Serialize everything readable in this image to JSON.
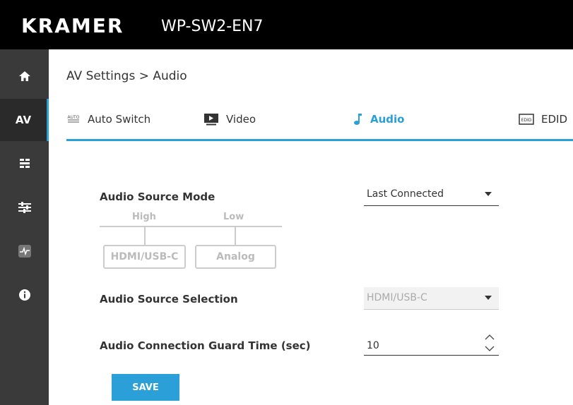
{
  "header": {
    "brand": "KRAMER",
    "model": "WP-SW2-EN7"
  },
  "sidebar": {
    "items": [
      {
        "name": "home-icon",
        "label": ""
      },
      {
        "name": "av-item",
        "label": "AV"
      },
      {
        "name": "device-icon",
        "label": ""
      },
      {
        "name": "sliders-icon",
        "label": ""
      },
      {
        "name": "diagnostics-icon",
        "label": ""
      },
      {
        "name": "info-icon",
        "label": ""
      }
    ],
    "accent": "#2a9fd8"
  },
  "breadcrumb": "AV Settings > Audio",
  "tabs": [
    {
      "label": "Auto Switch",
      "icon": "auto-switch-icon"
    },
    {
      "label": "Video",
      "icon": "video-icon"
    },
    {
      "label": "Audio",
      "icon": "music-note-icon",
      "active": true
    },
    {
      "label": "EDID",
      "icon": "edid-icon"
    }
  ],
  "form": {
    "source_mode": {
      "label": "Audio Source Mode",
      "value": "Last Connected"
    },
    "diagram": {
      "high": "High",
      "low": "Low",
      "box1": "HDMI/USB-C",
      "box2": "Analog"
    },
    "source_selection": {
      "label": "Audio Source Selection",
      "value": "HDMI/USB-C"
    },
    "guard_time": {
      "label": "Audio Connection Guard Time (sec)",
      "value": "10"
    }
  },
  "save_label": "SAVE"
}
